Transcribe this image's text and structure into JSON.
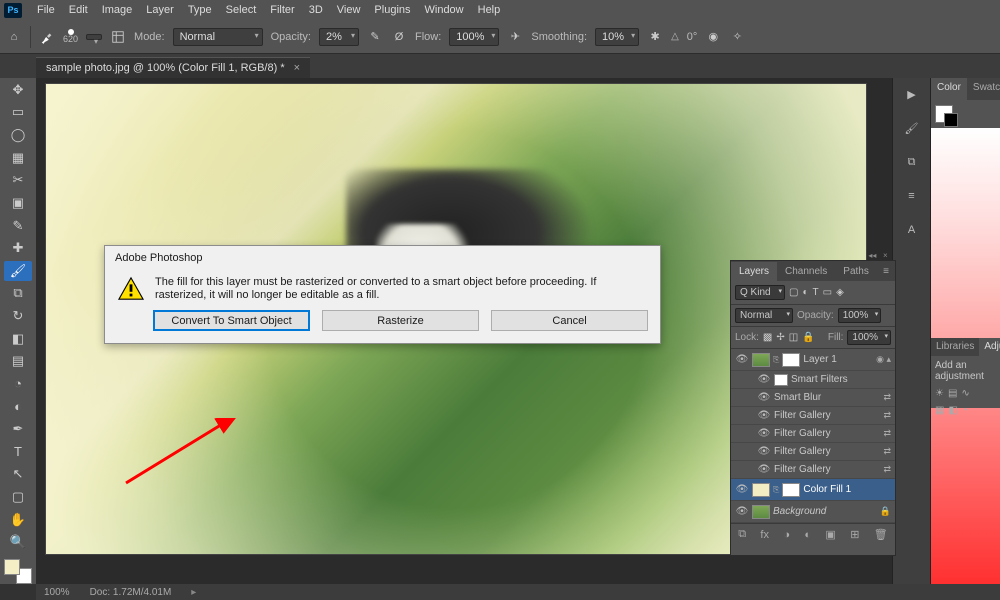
{
  "menu": [
    "File",
    "Edit",
    "Image",
    "Layer",
    "Type",
    "Select",
    "Filter",
    "3D",
    "View",
    "Plugins",
    "Window",
    "Help"
  ],
  "options": {
    "size_label": "620",
    "mode_label": "Mode:",
    "mode_value": "Normal",
    "opacity_label": "Opacity:",
    "opacity_value": "2%",
    "flow_label": "Flow:",
    "flow_value": "100%",
    "smoothing_label": "Smoothing:",
    "smoothing_value": "10%",
    "angle_icon": "△",
    "angle_value": "0°"
  },
  "document": {
    "tab_title": "sample photo.jpg @ 100% (Color Fill 1, RGB/8) *"
  },
  "dialog": {
    "title": "Adobe Photoshop",
    "message": "The fill for this layer must be rasterized or converted to a smart object before proceeding. If rasterized, it will no longer be editable as a fill.",
    "btn_convert": "Convert To Smart Object",
    "btn_rasterize": "Rasterize",
    "btn_cancel": "Cancel"
  },
  "layers_panel": {
    "tabs": [
      "Layers",
      "Channels",
      "Paths"
    ],
    "kind_label": "Q Kind",
    "blend_mode": "Normal",
    "opacity_label": "Opacity:",
    "opacity_value": "100%",
    "lock_label": "Lock:",
    "fill_label": "Fill:",
    "fill_value": "100%",
    "layers": [
      {
        "name": "Layer 1"
      },
      {
        "name": "Smart Filters",
        "is_header": true
      },
      {
        "name": "Smart Blur",
        "is_sub": true
      },
      {
        "name": "Filter Gallery",
        "is_sub": true
      },
      {
        "name": "Filter Gallery",
        "is_sub": true
      },
      {
        "name": "Filter Gallery",
        "is_sub": true
      },
      {
        "name": "Filter Gallery",
        "is_sub": true
      },
      {
        "name": "Color Fill 1",
        "selected": true
      },
      {
        "name": "Background",
        "locked": true
      }
    ]
  },
  "color_panel": {
    "tabs": [
      "Color",
      "Swatch"
    ]
  },
  "adjustments": {
    "tab1": "Libraries",
    "tab2": "Adju",
    "hint": "Add an adjustment"
  },
  "status": {
    "zoom": "100%",
    "doc_info": "Doc: 1.72M/4.01M"
  }
}
